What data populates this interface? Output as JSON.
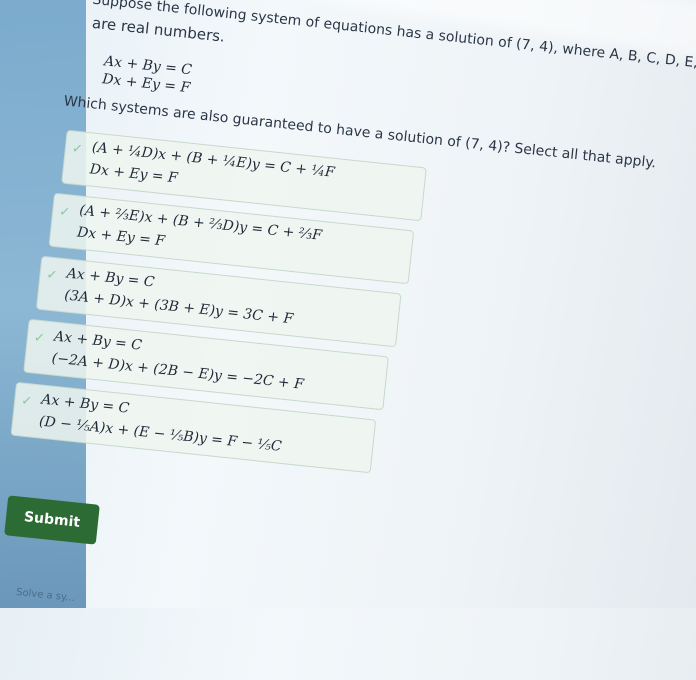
{
  "problem": {
    "intro": "Suppose the following system of equations has a solution of (7, 4), where A, B, C, D, E, an",
    "intro_continued": "are real numbers.",
    "system": [
      "Ax + By = C",
      "Dx + Ey = F"
    ],
    "question": "Which systems are also guaranteed to have a solution of (7, 4)? Select all that apply."
  },
  "choices": [
    {
      "line1": "(A + ¼D)x + (B + ¼E)y = C + ¼F",
      "line2": "Dx + Ey = F"
    },
    {
      "line1": "(A + ⅔E)x + (B + ⅔D)y = C + ⅔F",
      "line2": "Dx + Ey = F"
    },
    {
      "line1": "Ax + By = C",
      "line2": "(3A + D)x + (3B + E)y = 3C + F"
    },
    {
      "line1": "Ax + By = C",
      "line2": "(−2A + D)x + (2B − E)y = −2C + F"
    },
    {
      "line1": "Ax + By = C",
      "line2": "(D − ⅕A)x + (E − ⅕B)y = F − ⅕C"
    }
  ],
  "submit_label": "Submit",
  "footer_text": "Solve a sy...",
  "colors": {
    "accent": "#2c6b34",
    "sidebar": "#6fa3c8"
  }
}
